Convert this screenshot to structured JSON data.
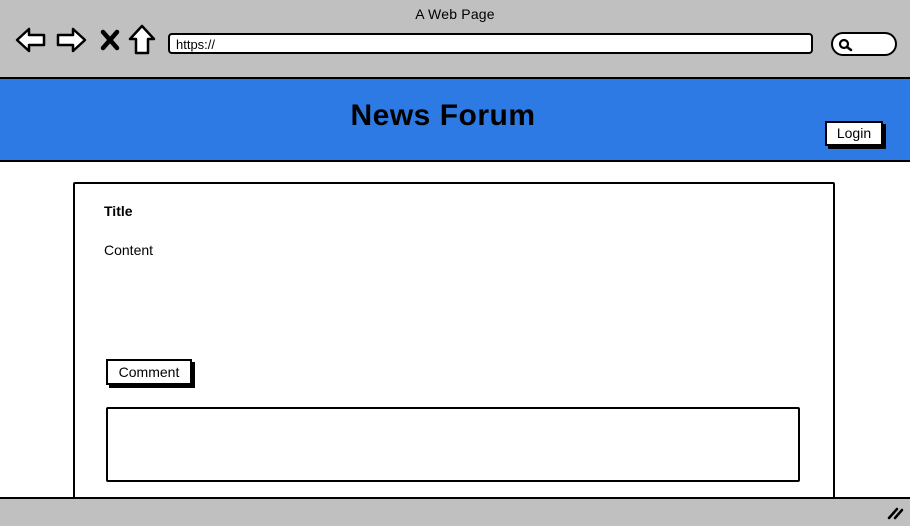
{
  "browser": {
    "window_title": "A Web Page",
    "url": "https://",
    "nav_icons": [
      "back-arrow-icon",
      "forward-arrow-icon",
      "close-icon",
      "home-icon"
    ],
    "search_icon": "search-icon"
  },
  "header": {
    "title": "News Forum",
    "login_label": "Login",
    "background_color": "#2d7ae5"
  },
  "post": {
    "title": "Title",
    "content": "Content",
    "comment_label": "Comment"
  },
  "colors": {
    "chrome": "#c0c0c0",
    "accent": "#2d7ae5"
  }
}
